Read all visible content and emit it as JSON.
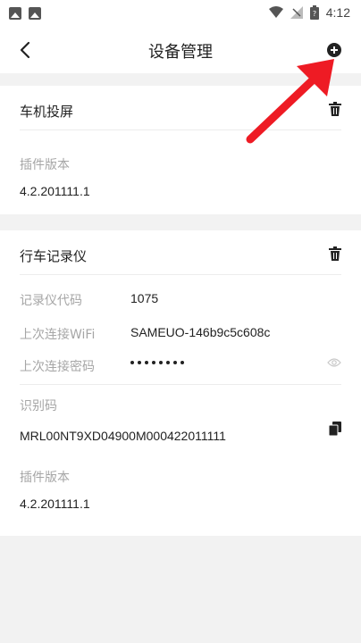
{
  "status_bar": {
    "time": "4:12",
    "icons": [
      "image-icon",
      "app-icon",
      "wifi-icon",
      "no-signal-icon",
      "battery-icon"
    ]
  },
  "header": {
    "title": "设备管理",
    "back_icon": "chevron-left-icon",
    "add_icon": "plus-circle-icon"
  },
  "screen_projection": {
    "title": "车机投屏",
    "plugin_version_label": "插件版本",
    "plugin_version": "4.2.201111.1"
  },
  "dashcam": {
    "title": "行车记录仪",
    "code_label": "记录仪代码",
    "code": "1075",
    "last_wifi_label": "上次连接WiFi",
    "last_wifi": "SAMEUO-146b9c5c608c",
    "last_password_label": "上次连接密码",
    "password_mask_count": 8,
    "id_label": "识别码",
    "id_code": "MRL00NT9XD04900M000422011111",
    "plugin_version_label": "插件版本",
    "plugin_version": "4.2.201111.1"
  },
  "colors": {
    "accent_arrow": "#ee1b24",
    "label_gray": "#a6a6a6",
    "background": "#f2f2f2"
  }
}
